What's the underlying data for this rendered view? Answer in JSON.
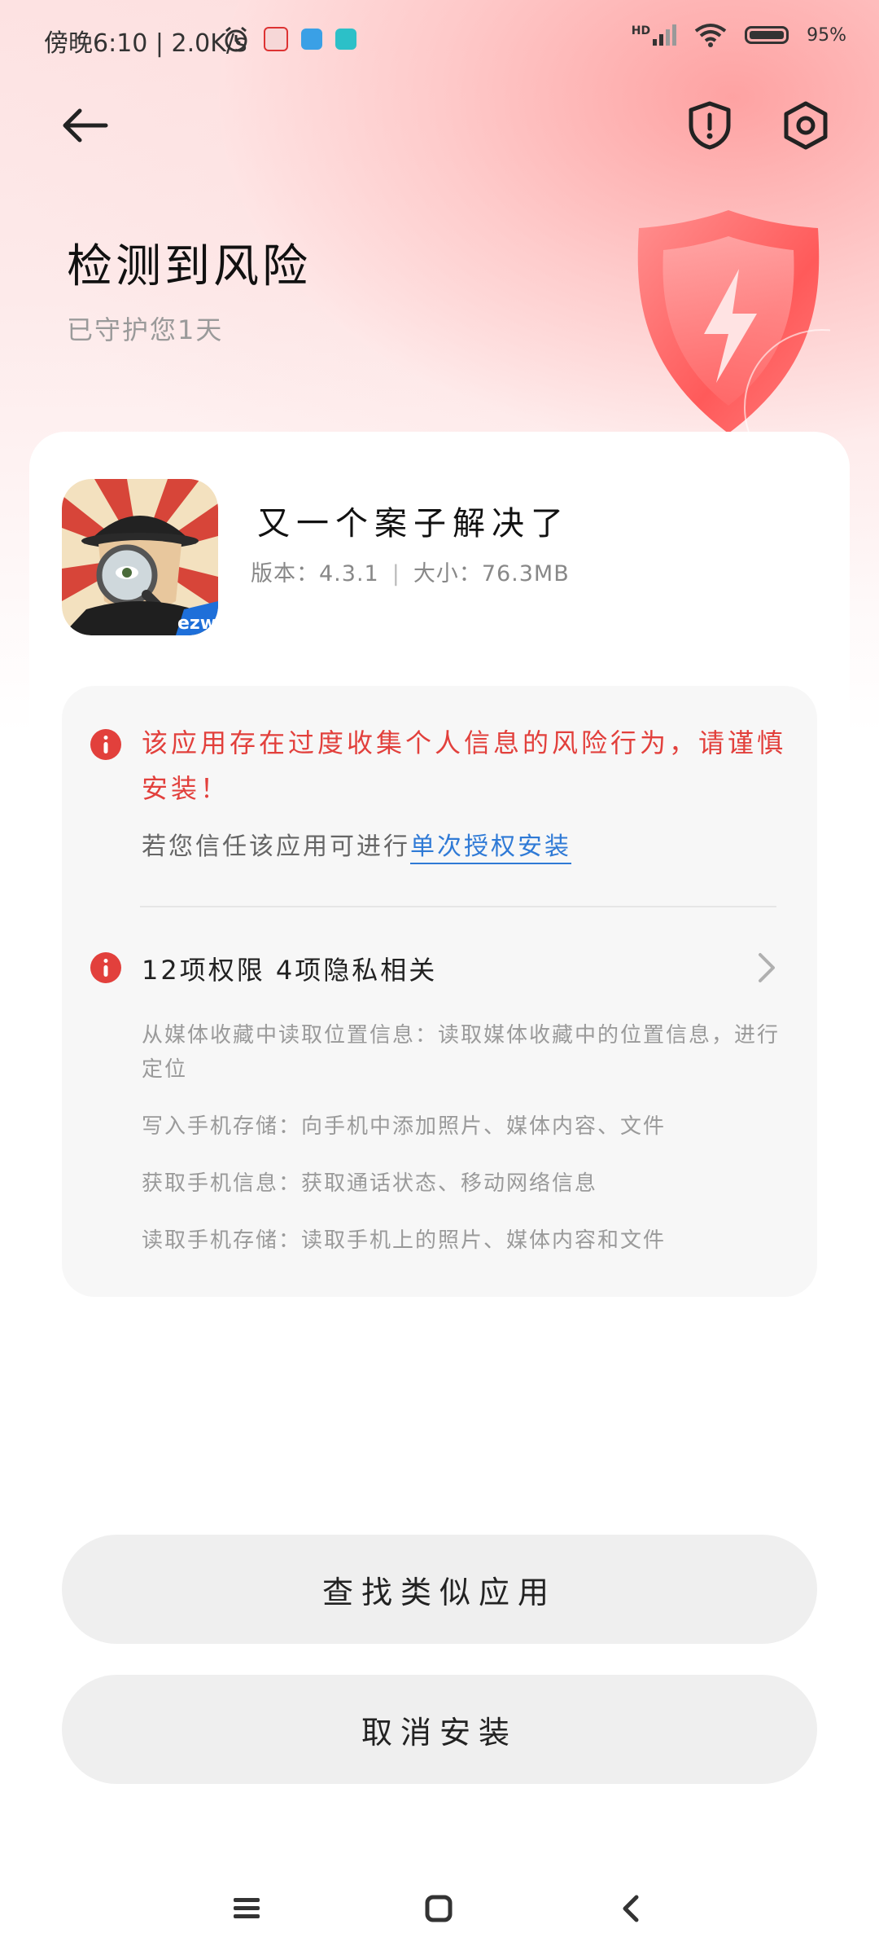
{
  "status_bar": {
    "time": "傍晚6:10 | 2.0K/s",
    "network_label": "HD",
    "battery": "95%"
  },
  "header": {
    "back_icon": "arrow-left-icon",
    "shield_icon": "shield-alert-icon",
    "settings_icon": "hexagon-gear-icon",
    "title": "检测到风险",
    "subtitle": "已守护您1天"
  },
  "app": {
    "name": "又一个案子解决了",
    "version_label": "版本：",
    "version": "4.3.1",
    "size_label": "大小：",
    "size": "76.3MB",
    "icon_badge": "ezw"
  },
  "risk": {
    "warning": "该应用存在过度收集个人信息的风险行为，请谨慎安装！",
    "trust_prefix": "若您信任该应用可进行",
    "trust_link": "单次授权安装",
    "permissions_summary": "12项权限 4项隐私相关",
    "permissions": [
      "从媒体收藏中读取位置信息：读取媒体收藏中的位置信息，进行定位",
      "写入手机存储：向手机中添加照片、媒体内容、文件",
      "获取手机信息：获取通话状态、移动网络信息",
      "读取手机存储：读取手机上的照片、媒体内容和文件"
    ]
  },
  "actions": {
    "find_similar": "查找类似应用",
    "cancel_install": "取消安装"
  },
  "colors": {
    "accent_red": "#e2403c",
    "link_blue": "#2f7ad6",
    "button_bg": "#efefef"
  }
}
